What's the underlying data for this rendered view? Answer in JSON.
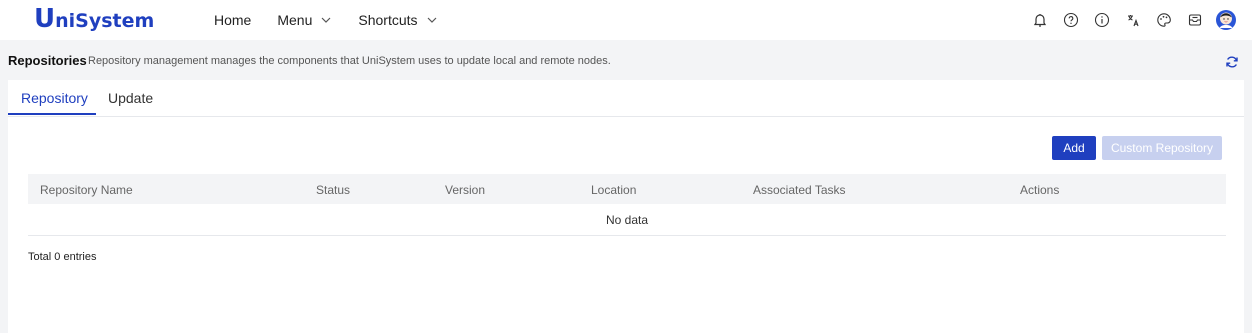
{
  "app": {
    "logo_initial": "U",
    "logo_rest": "niSystem",
    "brand_color": "#1f3fbf"
  },
  "nav": {
    "home": "Home",
    "menu": "Menu",
    "shortcuts": "Shortcuts"
  },
  "toolbar_icons": [
    "bell-icon",
    "question-circle-icon",
    "info-circle-icon",
    "translate-icon",
    "palette-icon",
    "inbox-icon",
    "user-avatar-icon"
  ],
  "page": {
    "title": "Repositories",
    "description": "Repository management manages the components that UniSystem uses to update local and remote nodes."
  },
  "tabs": [
    {
      "label": "Repository",
      "active": true
    },
    {
      "label": "Update",
      "active": false
    }
  ],
  "buttons": {
    "add": "Add",
    "custom_repository": "Custom Repository"
  },
  "table": {
    "columns": [
      "Repository Name",
      "Status",
      "Version",
      "Location",
      "Associated Tasks",
      "Actions"
    ],
    "empty_text": "No data",
    "rows": []
  },
  "footer": {
    "total": "Total 0 entries"
  }
}
